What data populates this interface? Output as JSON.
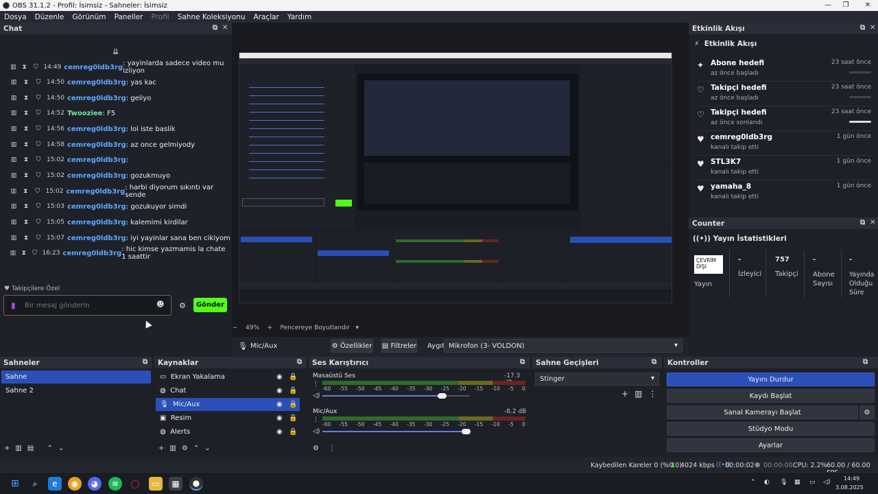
{
  "window": {
    "title": "OBS 31.1.2 - Profil: İsimsiz - Sahneler: İsimsiz"
  },
  "menu": [
    "Dosya",
    "Düzenle",
    "Görünüm",
    "Paneller",
    "Profil",
    "Sahne Koleksiyonu",
    "Araçlar",
    "Yardım"
  ],
  "chat": {
    "title": "Chat",
    "messages": [
      {
        "time": "14:49",
        "user": "cemreg0ldb3rg",
        "text": ": yayinlarda sadece video mu izliyon"
      },
      {
        "time": "14:50",
        "user": "cemreg0ldb3rg",
        "text": ": yas kac"
      },
      {
        "time": "14:50",
        "user": "cemreg0ldb3rg",
        "text": ": geliyo"
      },
      {
        "time": "14:52",
        "user": "Twooziee",
        "text": ": F5"
      },
      {
        "time": "14:56",
        "user": "cemreg0ldb3rg",
        "text": ": lol iste baslik"
      },
      {
        "time": "14:58",
        "user": "cemreg0ldb3rg",
        "text": ": az once gelmiyody"
      },
      {
        "time": "15:02",
        "user": "cemreg0ldb3rg",
        "text": ":"
      },
      {
        "time": "15:02",
        "user": "cemreg0ldb3rg",
        "text": ": gozukmuyo"
      },
      {
        "time": "15:02",
        "user": "cemreg0ldb3rg",
        "text": ": harbi diyorum sıkıntı var sende"
      },
      {
        "time": "15:03",
        "user": "cemreg0ldb3rg",
        "text": ": gozukuyor simdi"
      },
      {
        "time": "15:05",
        "user": "cemreg0ldb3rg",
        "text": ": kalemimi kirdilar"
      },
      {
        "time": "15:07",
        "user": "cemreg0ldb3rg",
        "text": ": iyi yayinlar sana ben cikiyom"
      },
      {
        "time": "16:23",
        "user": "cemreg0ldb3rg",
        "text": ": hic kimse yazmamis la chate 1 saattir"
      }
    ],
    "followers_label": "Takipçilere Özel",
    "input_placeholder": "Bir mesaj gönderin",
    "send_label": "Gönder"
  },
  "preview": {
    "zoom": "49%",
    "fit_label": "Pencereye Boyutlandır",
    "source_label": "Mic/Aux",
    "properties_label": "Özellikler",
    "filters_label": "Filtreler",
    "device_label": "Aygıt",
    "device_value": "Mikrofon (3- VOLDON)"
  },
  "events": {
    "title": "Etkinlik Akışı",
    "inner_title": "Etkinlik Akışı",
    "items": [
      {
        "title": "Abone hedefi",
        "sub": "az önce başladı",
        "time": "23 saat önce",
        "progress": 0
      },
      {
        "title": "Takipçi hedefi",
        "sub": "az önce başladı",
        "time": "23 saat önce",
        "progress": 0
      },
      {
        "title": "Takipçi hedefi",
        "sub": "az önce sonlandı",
        "time": "23 saat önce",
        "progress": 1
      },
      {
        "title": "cemreg0ldb3rg",
        "sub": "kanalı takip etti",
        "time": "1 gün önce"
      },
      {
        "title": "STL3K7",
        "sub": "kanalı takip etti",
        "time": "1 gün önce"
      },
      {
        "title": "yamaha_8",
        "sub": "kanalı takip etti",
        "time": "1 gün önce"
      }
    ]
  },
  "counter": {
    "title": "Counter",
    "stats_title": "Yayın İstatistikleri",
    "stats": [
      {
        "value": "ÇEVRİM DIŞI",
        "label": "Yayın"
      },
      {
        "value": "-",
        "label": "İzleyici"
      },
      {
        "value": "757",
        "label": "Takipçi"
      },
      {
        "value": "-",
        "label": "Abone Sayısı"
      },
      {
        "value": "-",
        "label": "Yayında Olduğu Süre"
      }
    ]
  },
  "scenes": {
    "title": "Sahneler",
    "items": [
      "Sahne",
      "Sahne 2"
    ],
    "selected": 0
  },
  "sources": {
    "title": "Kaynaklar",
    "items": [
      "Ekran Yakalama",
      "Chat",
      "Mic/Aux",
      "Resim",
      "Alerts"
    ],
    "selected": 2
  },
  "mixer": {
    "title": "Ses Karıştırıcı",
    "channels": [
      {
        "name": "Masaüstü Ses",
        "db": "-17.3 dB",
        "volume": 0.81
      },
      {
        "name": "Mic/Aux",
        "db": "-8.2 dB",
        "volume": 0.97
      }
    ],
    "scale": [
      "-60",
      "-55",
      "-50",
      "-45",
      "-40",
      "-35",
      "-30",
      "-25",
      "-20",
      "-15",
      "-10",
      "-5",
      "0"
    ]
  },
  "transitions": {
    "title": "Sahne Geçişleri",
    "value": "Stinger"
  },
  "controls": {
    "title": "Kontroller",
    "stop_stream": "Yayını Durdur",
    "start_record": "Kaydı Başlat",
    "virtual_cam": "Sanal Kamerayı Başlat",
    "studio_mode": "Stüdyo Modu",
    "settings": "Ayarlar"
  },
  "status": {
    "dropped": "Kaybedilen Kareler 0 (%0.0)",
    "bitrate": "4024 kbps",
    "stream_time": "00:00:02",
    "rec_time": "00:00:00",
    "cpu": "CPU: 2.2%",
    "fps": "60.00 / 60.00 FPS"
  },
  "taskbar": {
    "time": "14:49",
    "date": "3.08.2025"
  },
  "colors": {
    "accent": "#2b4fb8",
    "send": "#53fc18",
    "chat_name": "#5da8ff"
  }
}
